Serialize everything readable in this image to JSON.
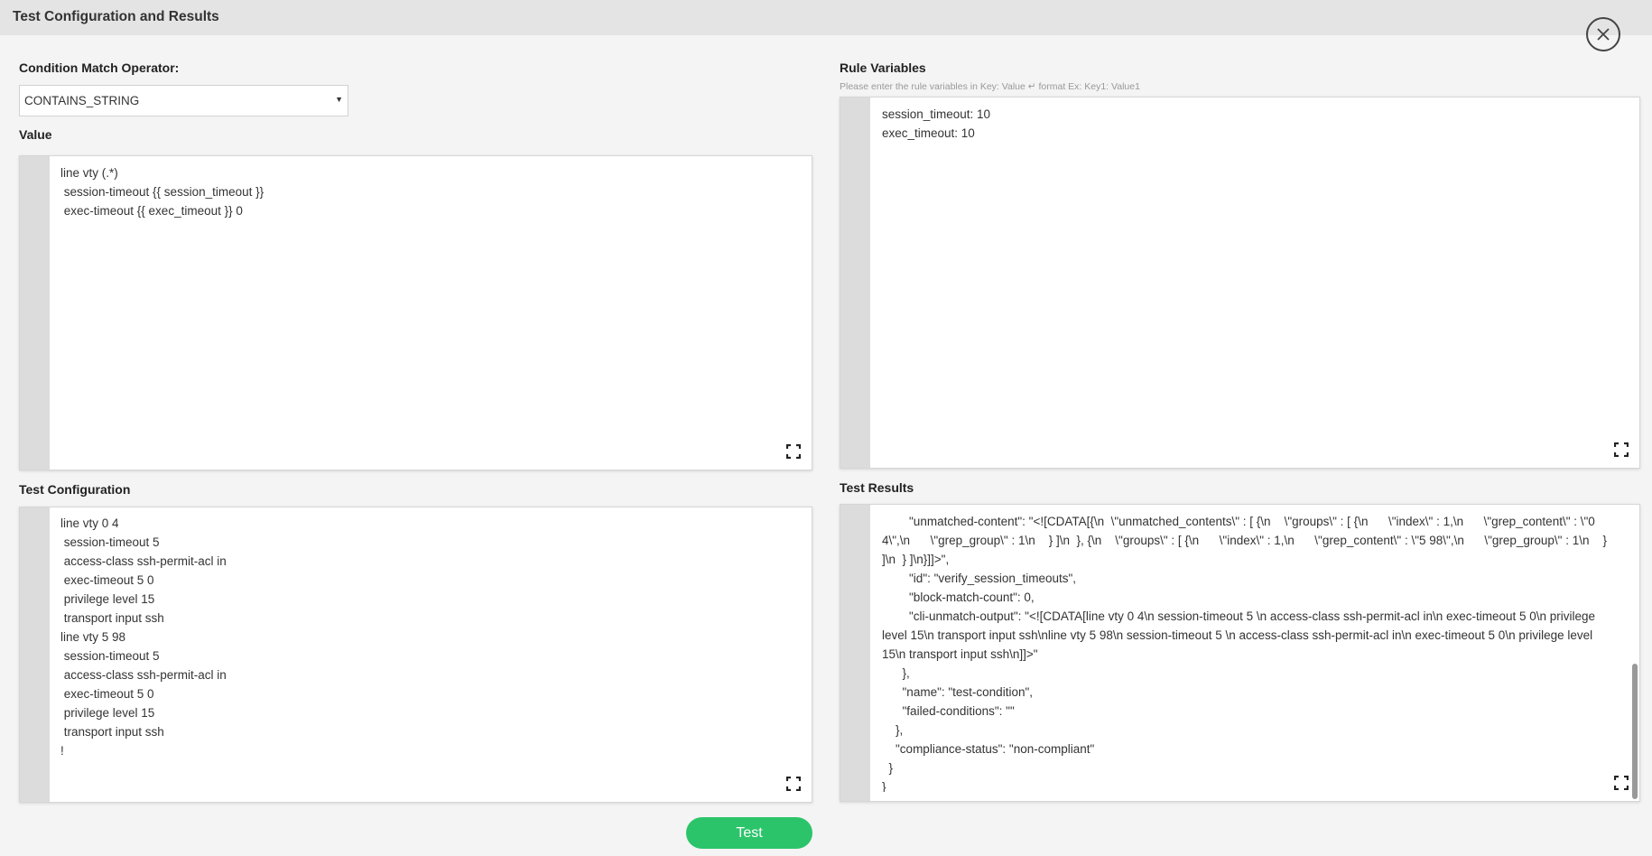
{
  "dialog": {
    "title": "Test Configuration and Results"
  },
  "condition_operator": {
    "label": "Condition Match Operator:",
    "selected": "CONTAINS_STRING"
  },
  "value": {
    "label": "Value",
    "text": "line vty (.*)\n session-timeout {{ session_timeout }}\n exec-timeout {{ exec_timeout }} 0"
  },
  "rule_variables": {
    "label": "Rule Variables",
    "hint": "Please enter the rule variables in Key: Value ↵ format Ex: Key1: Value1",
    "text": "session_timeout: 10\nexec_timeout: 10"
  },
  "test_configuration": {
    "label": "Test Configuration",
    "text": "line vty 0 4\n session-timeout 5\n access-class ssh-permit-acl in\n exec-timeout 5 0\n privilege level 15\n transport input ssh\nline vty 5 98\n session-timeout 5\n access-class ssh-permit-acl in\n exec-timeout 5 0\n privilege level 15\n transport input ssh\n!"
  },
  "test_results": {
    "label": "Test Results",
    "text": "        \"unmatched-content\": \"<![CDATA[{\\n  \\\"unmatched_contents\\\" : [ {\\n    \\\"groups\\\" : [ {\\n      \\\"index\\\" : 1,\\n      \\\"grep_content\\\" : \\\"0 4\\\",\\n      \\\"grep_group\\\" : 1\\n    } ]\\n  }, {\\n    \\\"groups\\\" : [ {\\n      \\\"index\\\" : 1,\\n      \\\"grep_content\\\" : \\\"5 98\\\",\\n      \\\"grep_group\\\" : 1\\n    } ]\\n  } ]\\n}]]>\",\n        \"id\": \"verify_session_timeouts\",\n        \"block-match-count\": 0,\n        \"cli-unmatch-output\": \"<![CDATA[line vty 0 4\\n session-timeout 5 \\n access-class ssh-permit-acl in\\n exec-timeout 5 0\\n privilege level 15\\n transport input ssh\\nline vty 5 98\\n session-timeout 5 \\n access-class ssh-permit-acl in\\n exec-timeout 5 0\\n privilege level 15\\n transport input ssh\\n]]>\"\n      },\n      \"name\": \"test-condition\",\n      \"failed-conditions\": \"\"\n    },\n    \"compliance-status\": \"non-compliant\"\n  }\n}"
  },
  "actions": {
    "test_label": "Test"
  }
}
